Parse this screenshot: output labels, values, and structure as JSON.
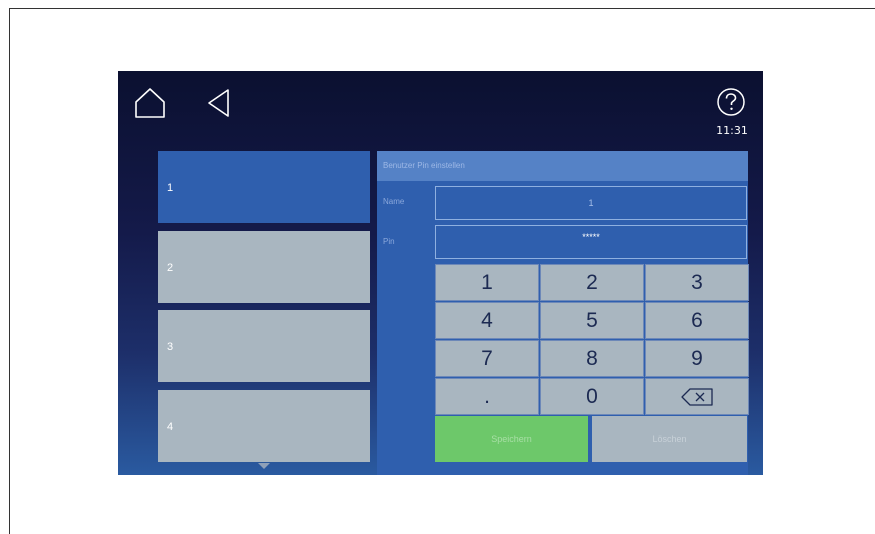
{
  "header": {
    "time": "11:31",
    "icons": [
      "home-icon",
      "back-icon",
      "help-icon"
    ]
  },
  "user_list": {
    "items": [
      {
        "label": "1",
        "active": true
      },
      {
        "label": "2",
        "active": false
      },
      {
        "label": "3",
        "active": false
      },
      {
        "label": "4",
        "active": false
      }
    ]
  },
  "panel": {
    "title": "Benutzer Pin einstellen",
    "name_label": "Name",
    "name_value": "1",
    "pin_label": "Pin",
    "pin_value": "*****"
  },
  "keypad": {
    "keys": [
      "1",
      "2",
      "3",
      "4",
      "5",
      "6",
      "7",
      "8",
      "9",
      ".",
      "0",
      "backspace"
    ]
  },
  "actions": {
    "save_label": "Speichern",
    "delete_label": "Löschen"
  },
  "colors": {
    "active_blue": "#2f5fae",
    "inactive_gray": "#a9b6c0",
    "save_green": "#6dc86a"
  }
}
